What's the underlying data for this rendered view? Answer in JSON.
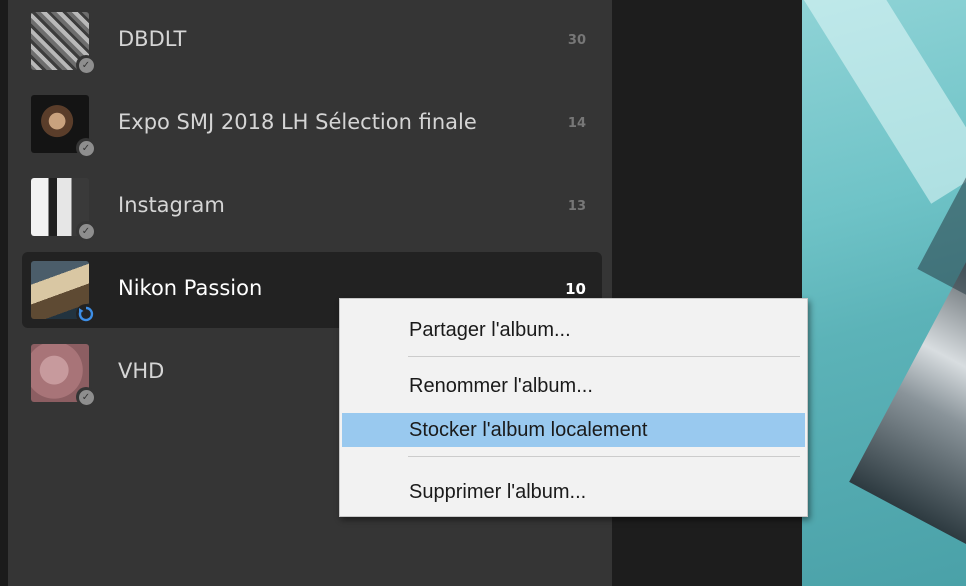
{
  "albums": [
    {
      "name": "DBDLT",
      "count": "30",
      "status_icon": "synced-check-icon"
    },
    {
      "name": "Expo SMJ 2018 LH Sélection finale",
      "count": "14",
      "status_icon": "synced-check-icon"
    },
    {
      "name": "Instagram",
      "count": "13",
      "status_icon": "synced-check-icon"
    },
    {
      "name": "Nikon Passion",
      "count": "10",
      "status_icon": "syncing-icon",
      "selected": true
    },
    {
      "name": "VHD",
      "count": "",
      "status_icon": "synced-check-icon"
    }
  ],
  "context_menu": {
    "items": [
      {
        "label": "Partager l'album..."
      },
      {
        "label": "Renommer l'album..."
      },
      {
        "label": "Stocker l'album localement",
        "highlighted": true
      },
      {
        "label": "Supprimer l'album..."
      }
    ]
  },
  "colors": {
    "sidebar_bg": "#353535",
    "selected_bg": "#222222",
    "menu_bg": "#f2f2f2",
    "menu_highlight": "#99c9ef",
    "sync_blue": "#3d8ee6"
  }
}
